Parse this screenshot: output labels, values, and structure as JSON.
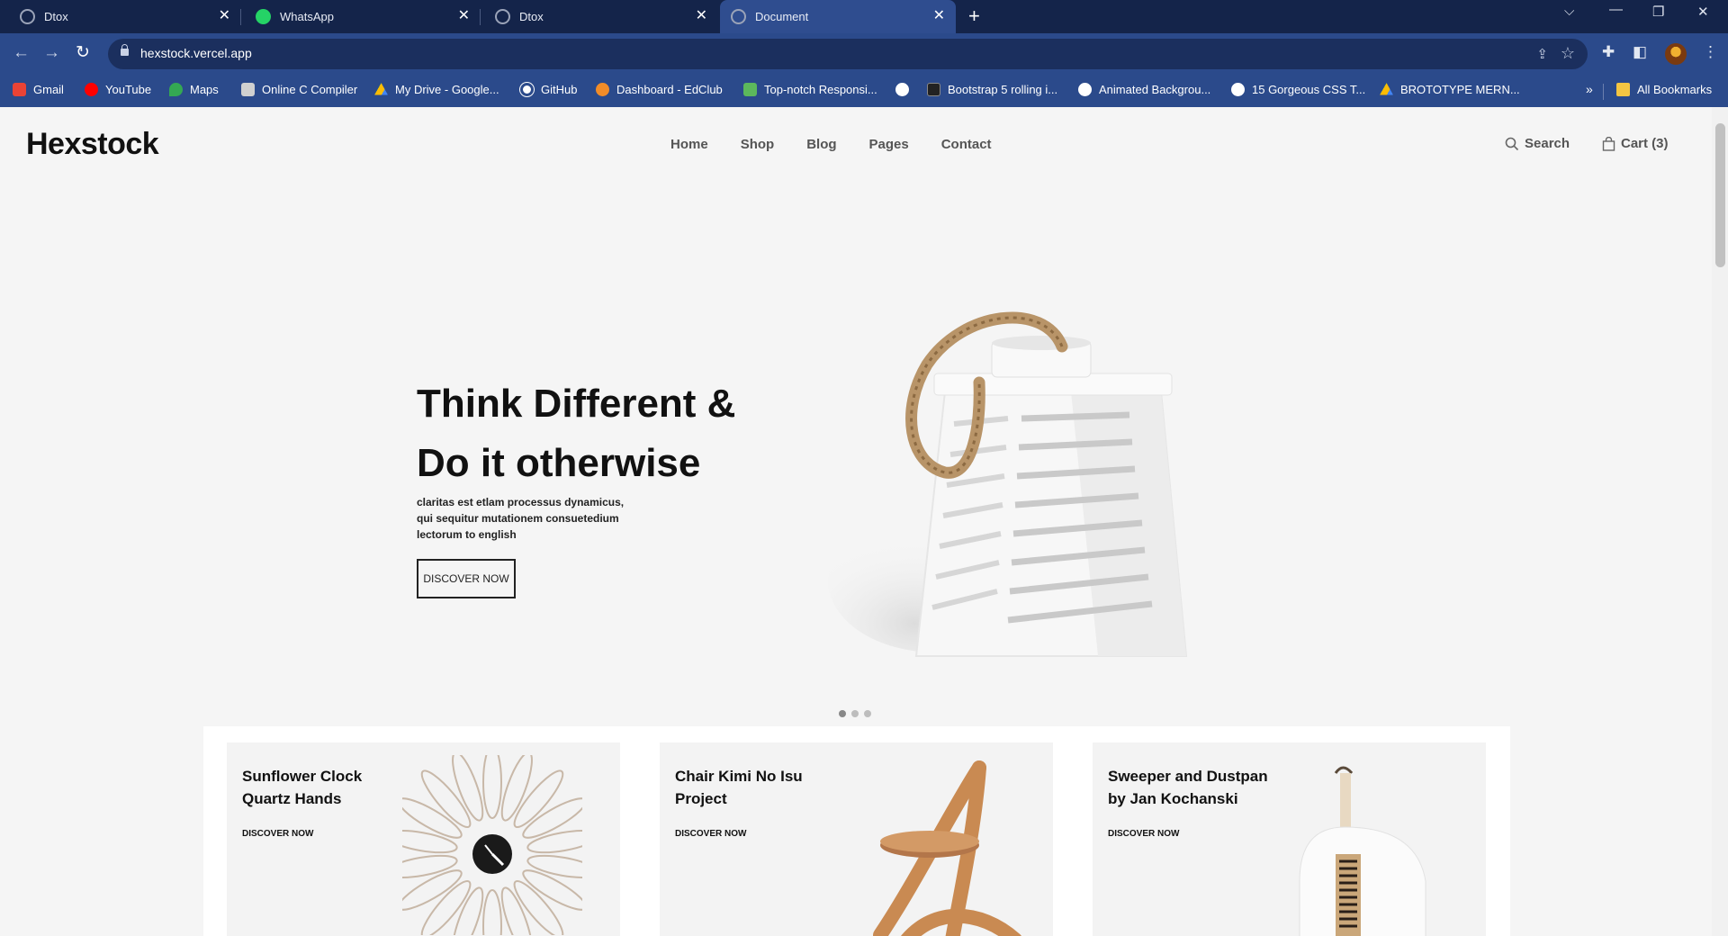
{
  "browser": {
    "tabs": [
      {
        "title": "Dtox",
        "icon": "globe-icon",
        "active": false
      },
      {
        "title": "WhatsApp",
        "icon": "whatsapp-icon",
        "active": false
      },
      {
        "title": "Dtox",
        "icon": "globe-icon",
        "active": false
      },
      {
        "title": "Document",
        "icon": "globe-icon",
        "active": true
      }
    ],
    "url": "hexstock.vercel.app",
    "bookmarks": [
      {
        "label": "Gmail",
        "color": "#ea4335"
      },
      {
        "label": "YouTube",
        "color": "#ff0000"
      },
      {
        "label": "Maps",
        "color": "#34a853"
      },
      {
        "label": "Online C Compiler",
        "color": "#d0d0d0"
      },
      {
        "label": "My Drive - Google...",
        "color": "#fbbc04"
      },
      {
        "label": "GitHub",
        "color": "#ffffff"
      },
      {
        "label": "Dashboard - EdClub",
        "color": "#f28c28"
      },
      {
        "label": "Top-notch Responsi...",
        "color": "#5cb85c"
      },
      {
        "label": "",
        "color": "#ffffff"
      },
      {
        "label": "Bootstrap 5 rolling i...",
        "color": "#222222"
      },
      {
        "label": "Animated Backgrou...",
        "color": "#ffffff"
      },
      {
        "label": "15 Gorgeous CSS T...",
        "color": "#ffffff"
      },
      {
        "label": "BROTOTYPE MERN...",
        "color": "#4285f4"
      }
    ],
    "all_bookmarks": "All Bookmarks"
  },
  "site": {
    "logo": "Hexstock",
    "nav": [
      "Home",
      "Shop",
      "Blog",
      "Pages",
      "Contact"
    ],
    "search_label": "Search",
    "cart_label": "Cart (3)"
  },
  "hero": {
    "title_line1": "Think Different &",
    "title_line2": "Do it otherwise",
    "description": "claritas est etlam processus dynamicus, qui sequitur mutationem consuetedium lectorum to english",
    "button": "DISCOVER NOW",
    "slides": 3,
    "active_slide": 1
  },
  "products": [
    {
      "title": "Sunflower Clock Quartz Hands",
      "link": "DISCOVER NOW"
    },
    {
      "title": "Chair Kimi No Isu Project",
      "link": "DISCOVER NOW"
    },
    {
      "title": "Sweeper and Dustpan by Jan Kochanski",
      "link": "DISCOVER NOW"
    }
  ]
}
